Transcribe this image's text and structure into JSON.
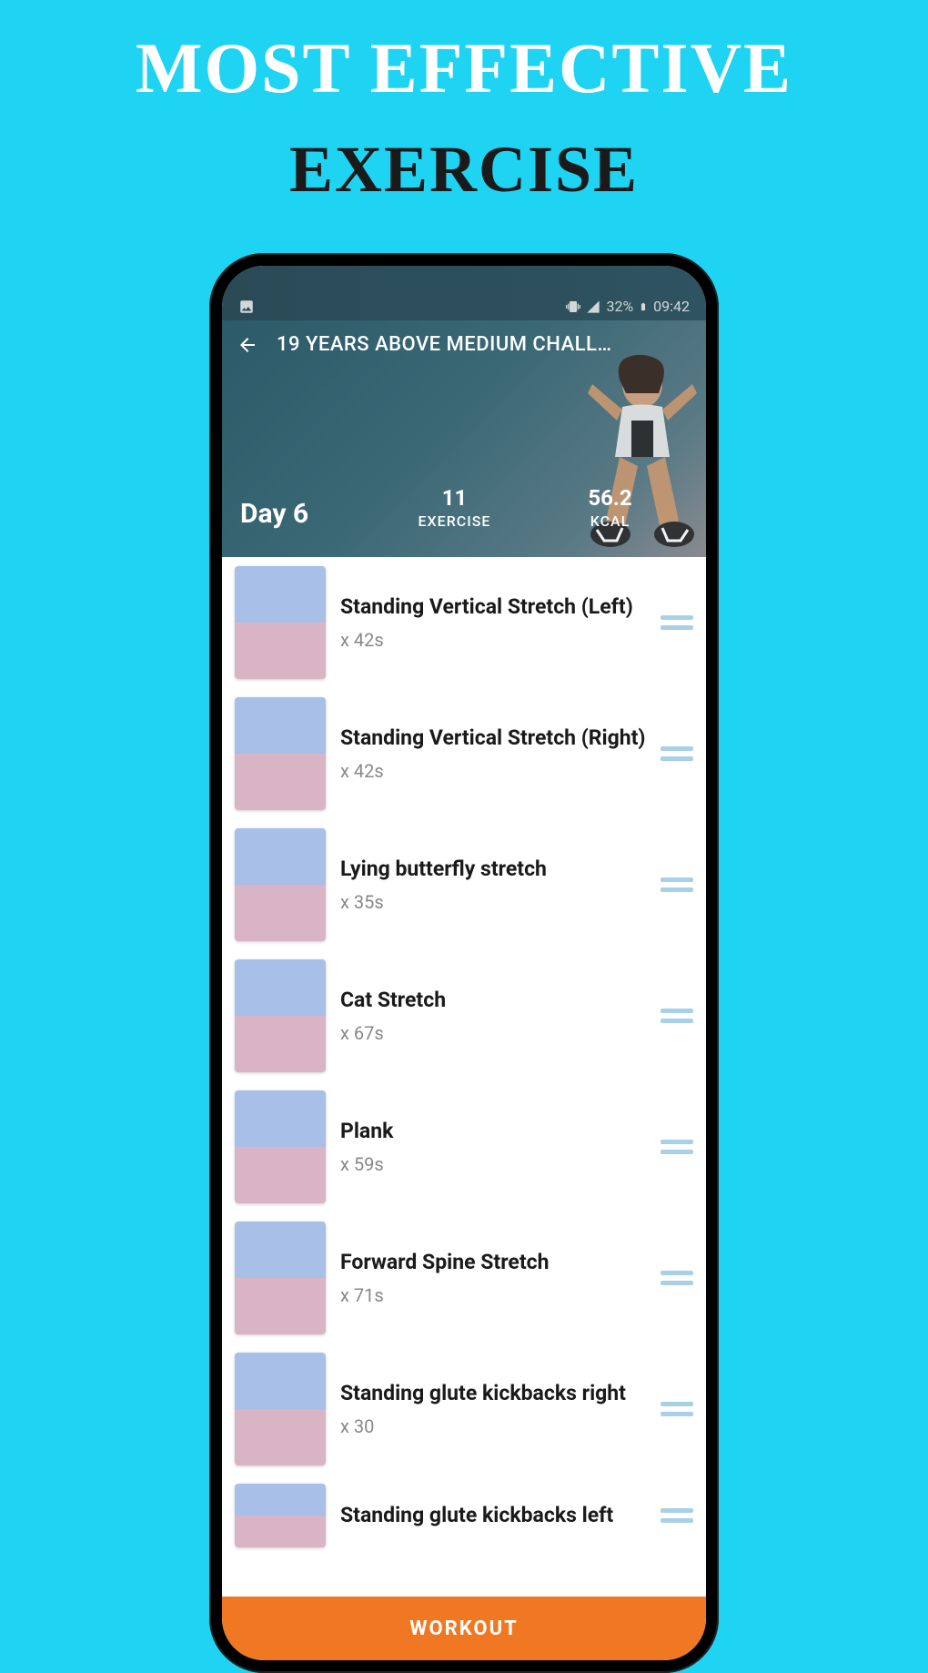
{
  "promo": {
    "line1": "MOST EFFECTIVE",
    "line2": "EXERCISE"
  },
  "status_bar": {
    "battery": "32%",
    "time": "09:42"
  },
  "header": {
    "title": "19 YEARS ABOVE MEDIUM CHALL…",
    "day": "Day 6",
    "exercise_count": "11",
    "exercise_label": "EXERCISE",
    "kcal": "56.2",
    "kcal_label": "KCAL"
  },
  "exercises": [
    {
      "name": "Standing Vertical Stretch (Left)",
      "duration": "x 42s"
    },
    {
      "name": "Standing Vertical Stretch (Right)",
      "duration": "x 42s"
    },
    {
      "name": "Lying butterfly stretch",
      "duration": "x 35s"
    },
    {
      "name": "Cat Stretch",
      "duration": "x 67s"
    },
    {
      "name": "Plank",
      "duration": "x 59s"
    },
    {
      "name": "Forward Spine Stretch",
      "duration": "x 71s"
    },
    {
      "name": "Standing glute kickbacks right",
      "duration": "x 30"
    },
    {
      "name": "Standing glute kickbacks left",
      "duration": ""
    }
  ],
  "cta": {
    "label": "WORKOUT"
  }
}
